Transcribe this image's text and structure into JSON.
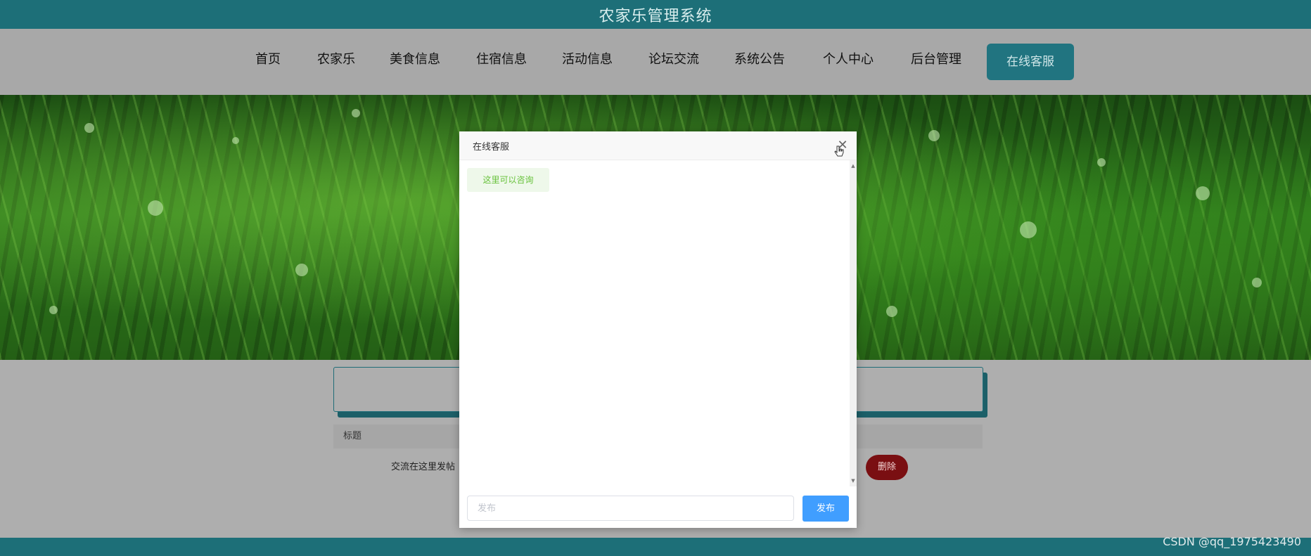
{
  "header": {
    "title": "农家乐管理系统"
  },
  "nav": {
    "items": [
      {
        "label": "首页"
      },
      {
        "label": "农家乐"
      },
      {
        "label": "美食信息"
      },
      {
        "label": "住宿信息"
      },
      {
        "label": "活动信息"
      },
      {
        "label": "论坛交流"
      },
      {
        "label": "系统公告"
      },
      {
        "label": "个人中心"
      },
      {
        "label": "后台管理"
      }
    ],
    "service_button": "在线客服"
  },
  "page": {
    "table_header": "标题",
    "row_text": "交流在这里发帖",
    "delete_label": "删除"
  },
  "chat_modal": {
    "title": "在线客服",
    "close_icon": "close-icon",
    "messages": [
      {
        "text": "这里可以咨询"
      }
    ],
    "input_placeholder": "发布",
    "input_value": "",
    "send_label": "发布"
  },
  "watermark": "CSDN @qq_1975423490",
  "colors": {
    "topbar": "#1d6f78",
    "service_button": "#217480",
    "send_button": "#409eff",
    "delete_button": "#7a0f12",
    "message_text": "#67c23a"
  }
}
